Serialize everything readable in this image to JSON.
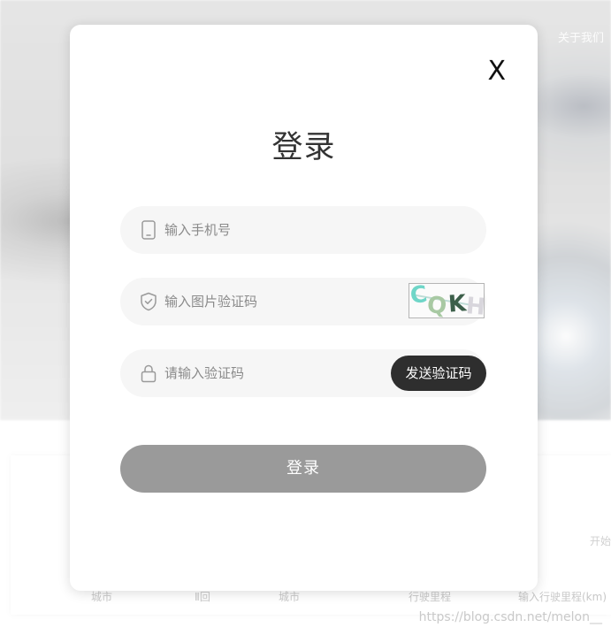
{
  "background": {
    "nav_link": "关于我们",
    "form_labels": [
      "城市",
      "Ⅱ回",
      "城市",
      "行驶里程",
      "输入行驶里程(km)"
    ],
    "right_fragment": "开始",
    "watermark": "https://blog.csdn.net/melon__"
  },
  "modal": {
    "close_label": "X",
    "title": "登录",
    "phone_placeholder": "输入手机号",
    "captcha_placeholder": "输入图片验证码",
    "captcha_text": [
      "C",
      "Q",
      "K",
      "H"
    ],
    "code_placeholder": "请输入验证码",
    "send_code_label": "发送验证码",
    "login_label": "登录"
  },
  "colors": {
    "accent_dark": "#2e2e2e",
    "login_button": "#9a9a9a",
    "field_bg": "#f6f6f6"
  },
  "icons": {
    "phone": "phone-icon",
    "captcha": "shield-check-icon",
    "code": "lock-icon",
    "close": "close-icon"
  }
}
